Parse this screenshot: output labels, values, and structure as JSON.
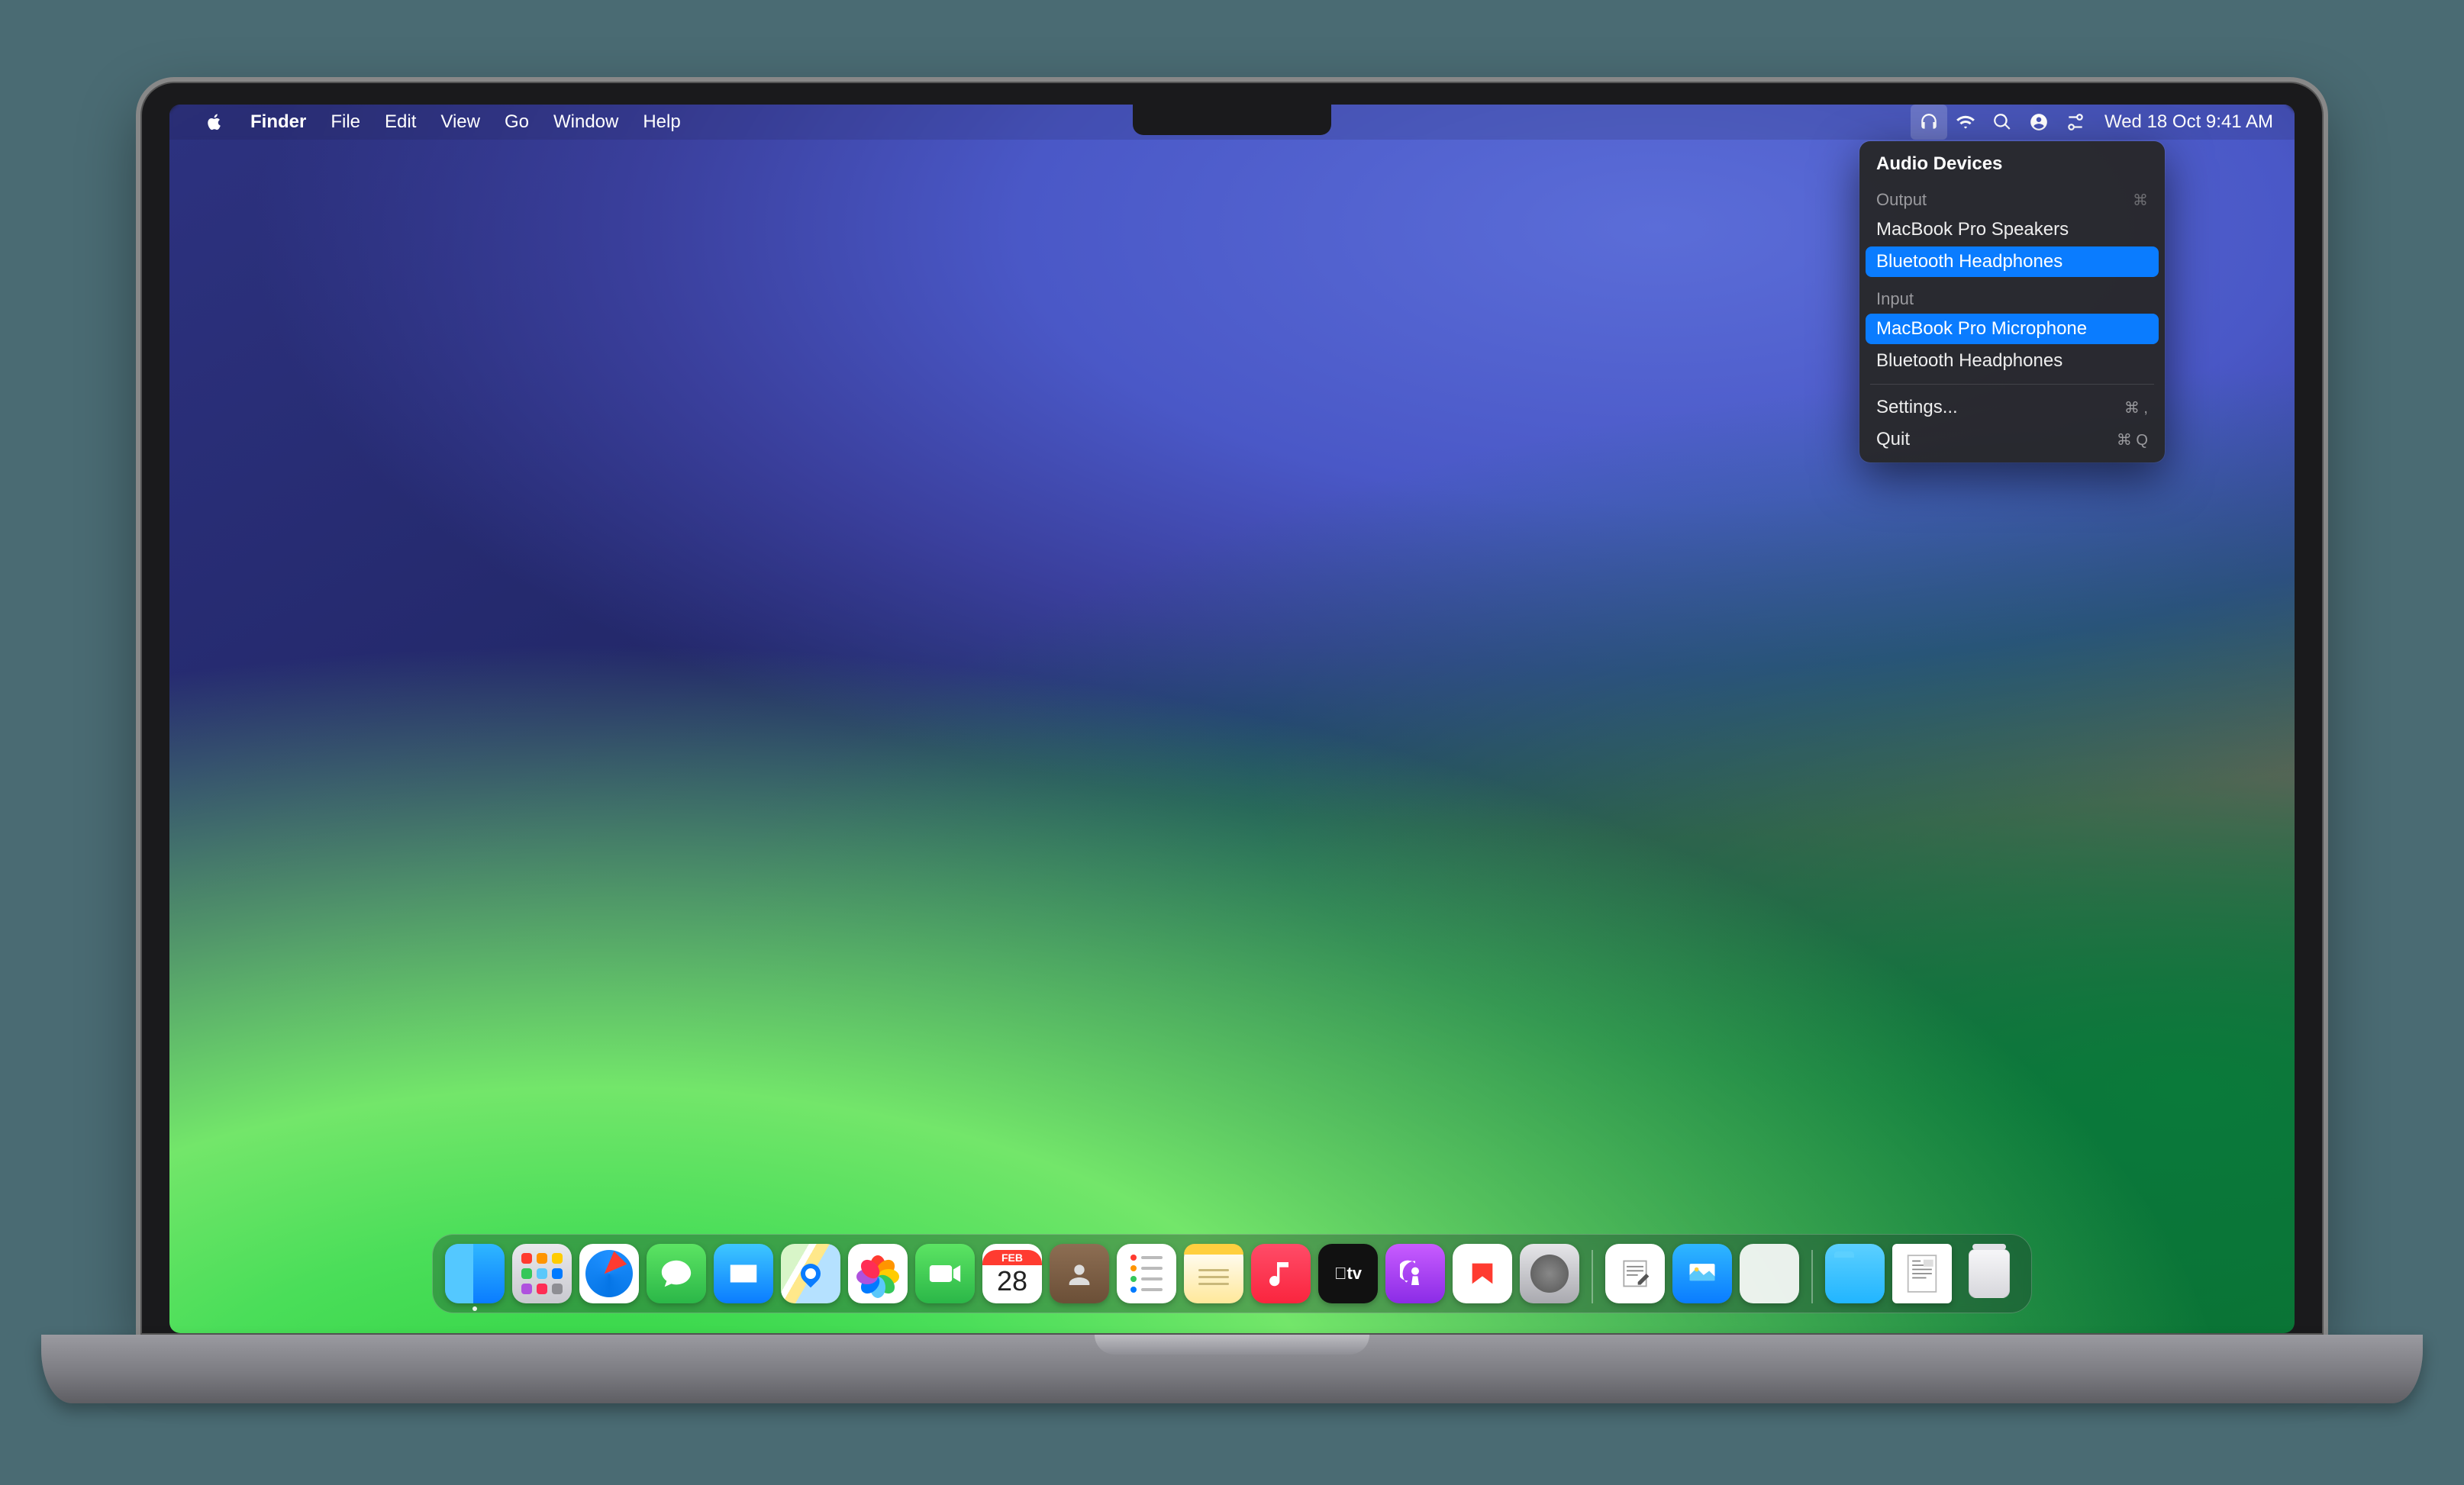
{
  "menubar": {
    "app_name": "Finder",
    "items": [
      "File",
      "Edit",
      "View",
      "Go",
      "Window",
      "Help"
    ],
    "clock": "Wed  18 Oct  9:41 AM"
  },
  "dropdown": {
    "title": "Audio Devices",
    "output_label": "Output",
    "output_shortcut": "⌘",
    "output_items": [
      {
        "label": "MacBook Pro Speakers",
        "selected": false
      },
      {
        "label": "Bluetooth Headphones",
        "selected": true
      }
    ],
    "input_label": "Input",
    "input_items": [
      {
        "label": "MacBook Pro Microphone",
        "selected": true
      },
      {
        "label": "Bluetooth Headphones",
        "selected": false
      }
    ],
    "footer": [
      {
        "label": "Settings...",
        "shortcut": "⌘ ,"
      },
      {
        "label": "Quit",
        "shortcut": "⌘ Q"
      }
    ]
  },
  "calendar": {
    "month": "FEB",
    "day": "28"
  },
  "tv_label": "tv",
  "dock_apps": [
    "finder",
    "launchpad",
    "safari",
    "messages",
    "mail",
    "maps",
    "photos",
    "facetime",
    "calendar",
    "contacts",
    "reminders",
    "notes",
    "music",
    "tv",
    "podcasts",
    "news",
    "settings"
  ],
  "dock_right": [
    "textedit",
    "preview",
    "blank-app"
  ],
  "dock_far": [
    "folder",
    "doc-stack",
    "trash"
  ]
}
